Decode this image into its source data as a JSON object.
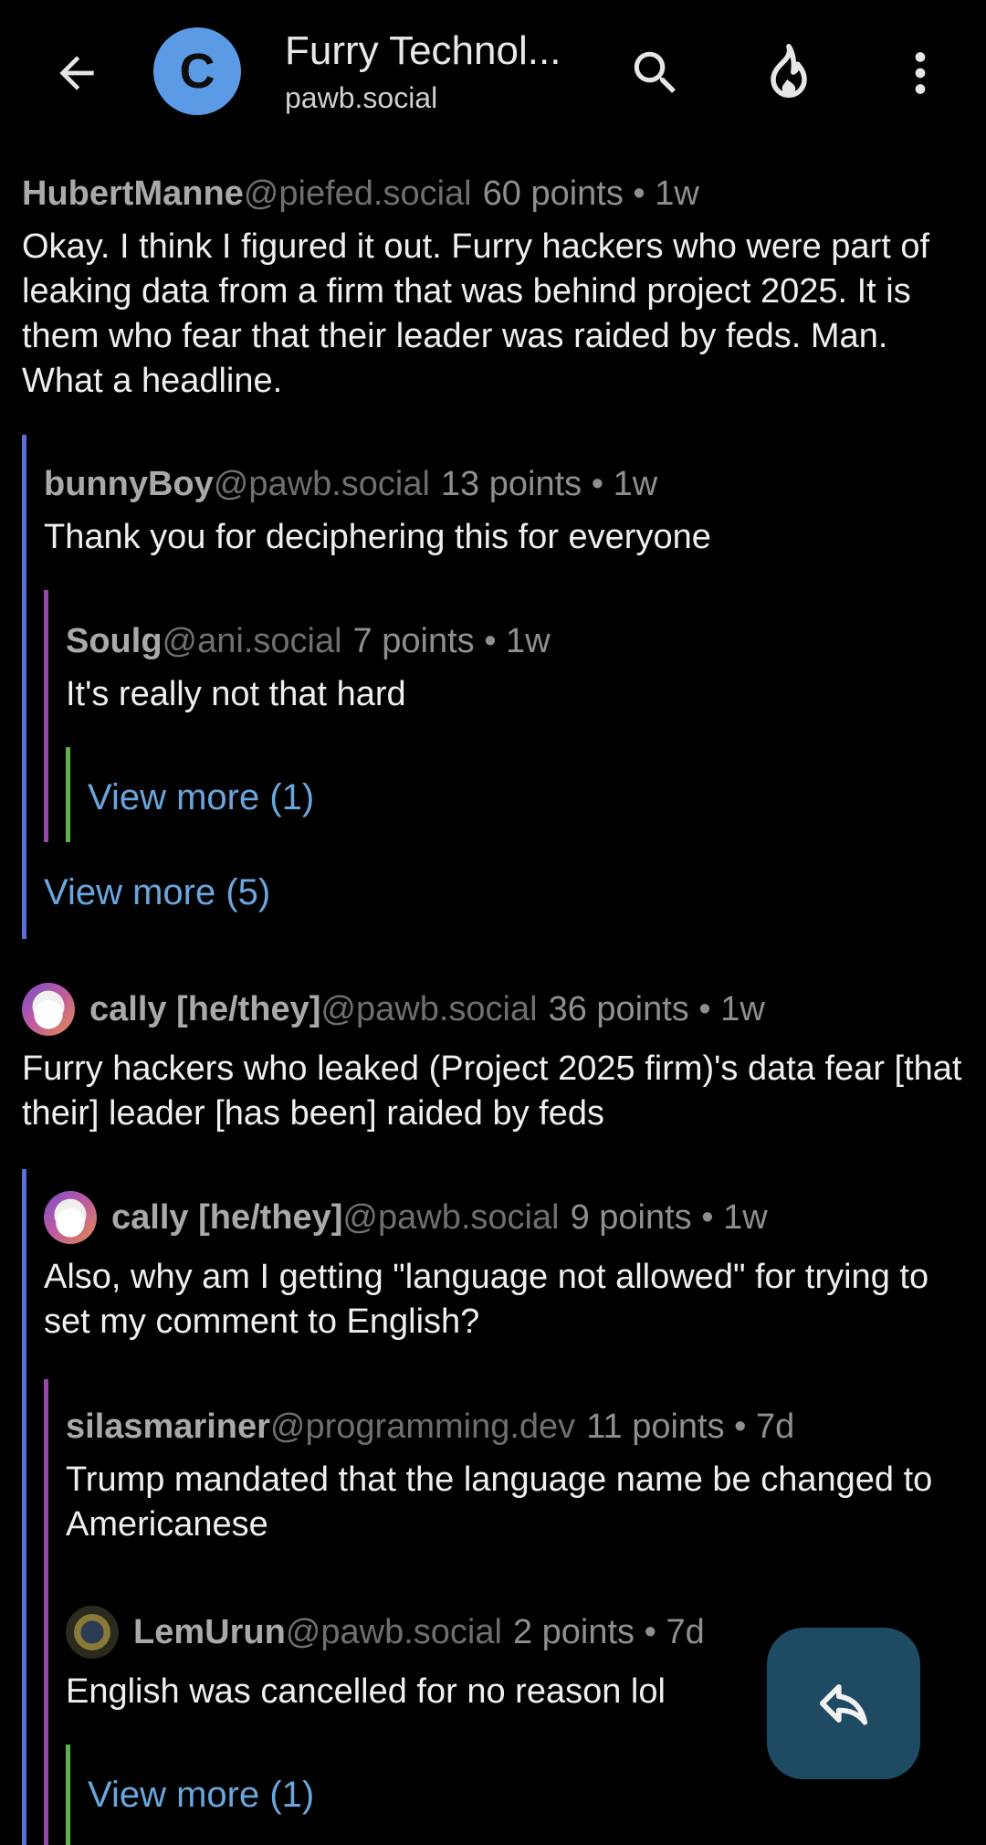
{
  "header": {
    "avatar_letter": "C",
    "title": "Furry Technol...",
    "instance": "pawb.social"
  },
  "icons": {
    "back": "arrow-left-icon",
    "search": "search-icon",
    "sort": "flame-icon",
    "more": "more-vert-icon",
    "reply": "reply-icon"
  },
  "colors": {
    "avatar_bg": "#5b9be6",
    "link": "#6aa6de",
    "thread_level1": "#5c6fd6",
    "thread_level2": "#9a44b0",
    "thread_level3": "#5fae4f",
    "fab_bg": "#1f4a63"
  },
  "comments": {
    "c1": {
      "user": "HubertManne",
      "instance": "@piefed.social",
      "points": "60 points • 1w",
      "body": "Okay. I think I figured it out. Furry hackers who were part of leaking data from a firm that was behind project 2025. It is them who fear that their leader was raided by feds. Man. What a headline."
    },
    "c1r1": {
      "user": "bunnyBoy",
      "instance": "@pawb.social",
      "points": "13 points • 1w",
      "body": "Thank you for deciphering this for everyone"
    },
    "c1r1r1": {
      "user": "Soulg",
      "instance": "@ani.social",
      "points": "7 points • 1w",
      "body": "It's really not that hard",
      "view_more": "View more (1)"
    },
    "c1r1_view_more": "View more (5)",
    "c2": {
      "user": "cally [he/they]",
      "instance": "@pawb.social",
      "points": "36 points • 1w",
      "body": "Furry hackers who leaked (Project 2025 firm)'s data fear [that their] leader [has been] raided by feds"
    },
    "c2r1": {
      "user": "cally [he/they]",
      "instance": "@pawb.social",
      "points": "9 points • 1w",
      "body": "Also, why am I getting \"language not allowed\" for trying to set my comment to English?"
    },
    "c2r1r1": {
      "user": "silasmariner",
      "instance": "@programming.dev",
      "points": "11 points • 7d",
      "body": "Trump mandated that the language name be changed to Americanese"
    },
    "c2r1r2": {
      "user": "LemUrun",
      "instance": "@pawb.social",
      "points": "2 points • 7d",
      "body": "English was cancelled for no reason lol",
      "view_more": "View more (1)"
    }
  }
}
